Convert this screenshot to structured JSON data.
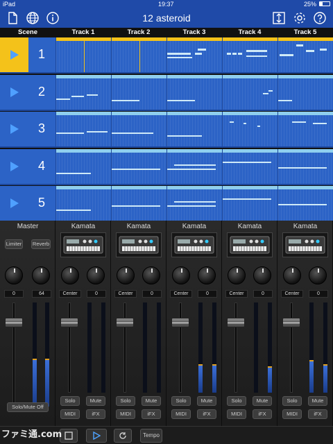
{
  "status": {
    "device": "iPad",
    "time": "19:37",
    "battery": "25%"
  },
  "nav": {
    "title": "12 asteroid"
  },
  "headers": {
    "scene": "Scene",
    "tracks": [
      "Track 1",
      "Track 2",
      "Track 3",
      "Track 4",
      "Track 5"
    ]
  },
  "scenes": [
    {
      "num": "1"
    },
    {
      "num": "2"
    },
    {
      "num": "3"
    },
    {
      "num": "4"
    },
    {
      "num": "5"
    }
  ],
  "active_scene": 1,
  "master": {
    "name": "Master",
    "limiter": "Limiter",
    "reverb": "Reverb",
    "val_left": "0",
    "val_right": "64",
    "solo_mute_off": "Solo/Mute Off",
    "meter_levels": [
      0.45,
      0.45
    ]
  },
  "strips": [
    {
      "name": "Kamata",
      "pan": "Center",
      "send": "0",
      "solo": "Solo",
      "mute": "Mute",
      "midi": "MIDI",
      "ifx": "iFX",
      "meter_levels": [
        0,
        0
      ]
    },
    {
      "name": "Kamata",
      "pan": "Center",
      "send": "0",
      "solo": "Solo",
      "mute": "Mute",
      "midi": "MIDI",
      "ifx": "iFX",
      "meter_levels": [
        0,
        0
      ]
    },
    {
      "name": "Kamata",
      "pan": "Center",
      "send": "0",
      "solo": "Solo",
      "mute": "Mute",
      "midi": "MIDI",
      "ifx": "iFX",
      "meter_levels": [
        0.3,
        0.3
      ]
    },
    {
      "name": "Kamata",
      "pan": "Center",
      "send": "0",
      "solo": "Solo",
      "mute": "Mute",
      "midi": "MIDI",
      "ifx": "iFX",
      "meter_levels": [
        0,
        0.28
      ]
    },
    {
      "name": "Kamata",
      "pan": "Center",
      "send": "0",
      "solo": "Solo",
      "mute": "Mute",
      "midi": "MIDI",
      "ifx": "iFX",
      "meter_levels": [
        0.35,
        0.3
      ]
    }
  ],
  "transport": {
    "tempo": "Tempo"
  },
  "watermark": "ファミ通.com",
  "colors": {
    "accent": "#f4c21a",
    "navbar": "#1f4aa8",
    "clip": "#2c63c6",
    "clip_bar": "#8fcfee"
  }
}
